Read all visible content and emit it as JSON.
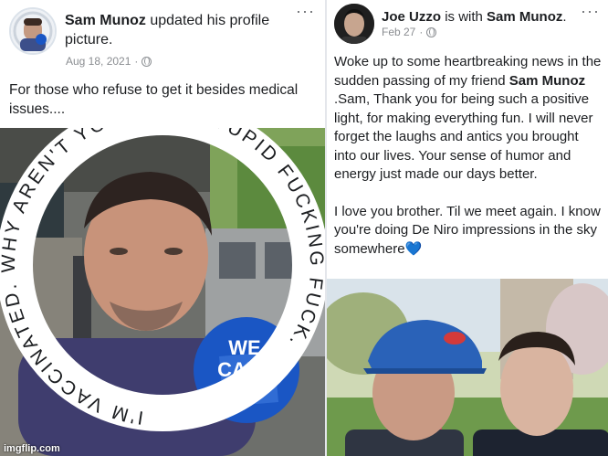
{
  "left_post": {
    "author": "Sam Munoz",
    "action": "updated his profile picture.",
    "date": "Aug 18, 2021",
    "separator": "·",
    "menu": "···",
    "text": "For those who refuse to get it besides medical issues....",
    "profile_ring_text": "I'M VACCINATED. WHY AREN'T YOU, YOU STUPID FUCKING FUCK.",
    "badge_text": "WE CAN DO"
  },
  "right_post": {
    "author": "Joe Uzzo",
    "with_text": "is with",
    "tagged": "Sam Munoz",
    "date": "Feb 27",
    "separator": "·",
    "menu": "···",
    "text_line1": "Woke up to some heartbreaking news in the sudden passing of my friend",
    "text_bold": "Sam Munoz",
    "text_line2": ".Sam, Thank you for being such a positive light, for making everything fun. I will never forget the laughs and antics you brought into our lives. Your sense of humor and energy just made our days better.",
    "text_para2": "I love you brother. Til we meet again. I know you're doing De Niro impressions in the sky somewhere",
    "heart": "💙"
  },
  "watermark": "imgflip.com",
  "colors": {
    "globe": "#8a8d91",
    "heart": "#1e88e5",
    "badge": "#1a56c4"
  }
}
